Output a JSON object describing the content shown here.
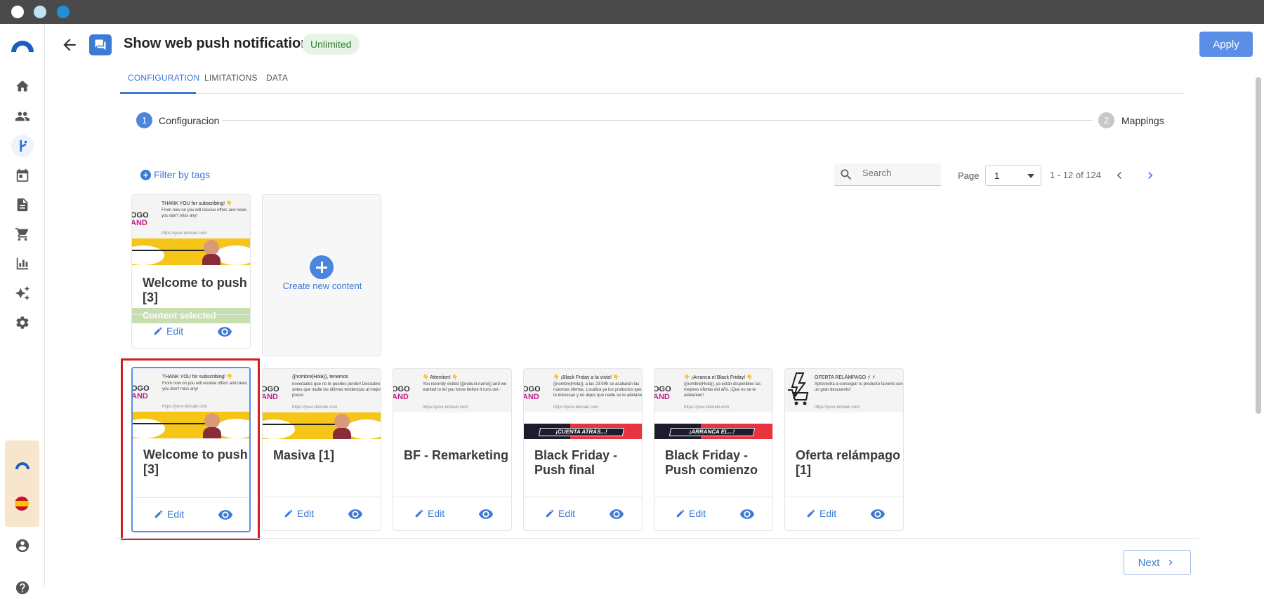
{
  "header": {
    "title": "Show web push notification",
    "badge": "Unlimited",
    "apply_label": "Apply"
  },
  "tabs": [
    {
      "label": "CONFIGURATION",
      "active": true
    },
    {
      "label": "LIMITATIONS",
      "active": false
    },
    {
      "label": "DATA",
      "active": false
    }
  ],
  "stepper": {
    "steps": [
      {
        "number": "1",
        "label": "Configuracion"
      },
      {
        "number": "2",
        "label": "Mappings"
      }
    ]
  },
  "toolbar": {
    "filter_label": "Filter by tags",
    "search_placeholder": "Search",
    "page_label": "Page",
    "page_value": "1",
    "range_text": "1 - 12 of 124"
  },
  "selected_card": {
    "name": "Welcome to push [3]",
    "selected_text": "Content selected",
    "edit_label": "Edit",
    "thumb": {
      "logo_top": "OGO",
      "logo_bottom": "AND",
      "title": "THANK YOU for subscribing! 👇",
      "body": "From now on you will receive offers and news you don't miss any!",
      "url": "https://your-domain.com"
    }
  },
  "create_card": {
    "label": "Create new content"
  },
  "cards": [
    {
      "name": "Welcome to push [3]",
      "edit_label": "Edit",
      "thumb": {
        "logo_top": "OGO",
        "logo_bottom": "AND",
        "title": "THANK YOU for subscribing! 👇",
        "body": "From now on you will receive offers and news you don't miss any!",
        "url": "https://your-domain.com",
        "banner": "yellow"
      }
    },
    {
      "name": "Masiva [1]",
      "edit_label": "Edit",
      "thumb": {
        "logo_top": "OGO",
        "logo_bottom": "AND",
        "title": "{{nombre|Hola}}, tenemos",
        "body": "novedades que no te puedes perder! Descubre antes que nadie las últimas tendencias al mejor precio",
        "url": "https://your-domain.com",
        "banner": "yellow"
      }
    },
    {
      "name": "BF - Remarketing",
      "edit_label": "Edit",
      "thumb": {
        "logo_top": "OGO",
        "logo_bottom": "AND",
        "title": "👇 Attention! 👇",
        "body": "You recently visited {{product-name}} and we wanted to let you know before it runs out -",
        "url": "https://your-domain.com",
        "banner": "none"
      }
    },
    {
      "name": "Black Friday - Push final",
      "edit_label": "Edit",
      "thumb": {
        "logo_top": "OGO",
        "logo_bottom": "AND",
        "title": "👇 ¡Black Friday a la vista! 👇",
        "body": "{{nombre|Hola}}, a las 23:59h se acabarán las nuestras ofertas. Localiza ya los productos que te interesan y no dejes que nadie se te adelante",
        "url": "https://your-domain.com",
        "banner": "red",
        "banner_text": "¡CUENTA ATRÁS...!"
      }
    },
    {
      "name": "Black Friday - Push comienzo",
      "edit_label": "Edit",
      "thumb": {
        "logo_top": "OGO",
        "logo_bottom": "AND",
        "title": "👇 ¡Arranca el Black Friday! 👇",
        "body": "{{nombre|Hola}}, ya están disponibles las mejores ofertas del año. ¡Que no se te adelanten!",
        "url": "https://your-domain.com",
        "banner": "red",
        "banner_text": "¡ARRANCA EL...!"
      }
    },
    {
      "name": "Oferta relámpago [1]",
      "edit_label": "Edit",
      "thumb": {
        "logo_top": "",
        "logo_bottom": "",
        "title": "OFERTA RELÁMPAGO ⚡ ⚡",
        "body": "Aprovecha a conseguir tu producto favorito con un gran descuento!",
        "url": "https://your-domain.com",
        "banner": "none"
      }
    }
  ],
  "footer": {
    "next_label": "Next"
  },
  "sidebar": {
    "items": [
      "home-icon",
      "people-icon",
      "flow-icon",
      "calendar-icon",
      "document-icon",
      "cart-icon",
      "chart-icon",
      "sparkle-icon",
      "settings-icon",
      "account-icon",
      "help-icon"
    ]
  },
  "colors": {
    "accent": "#3d7ad6",
    "apply": "#5b8ee6",
    "highlight": "#d21f1f",
    "badge_bg": "#e5f4e3"
  }
}
